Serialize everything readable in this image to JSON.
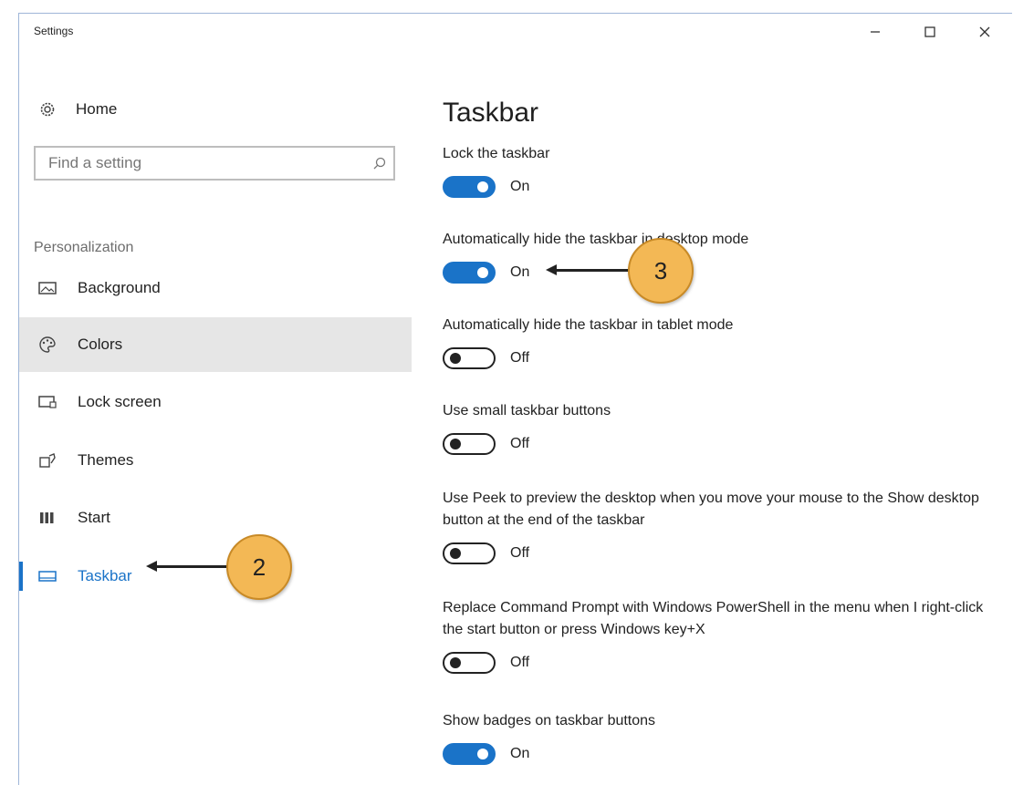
{
  "window": {
    "title": "Settings",
    "controls": {
      "minimize": "–",
      "maximize": "☐",
      "close": "✕"
    }
  },
  "sidebar": {
    "home_label": "Home",
    "search": {
      "placeholder": "Find a setting"
    },
    "section_label": "Personalization",
    "items": [
      {
        "label": "Background",
        "icon": "background-icon"
      },
      {
        "label": "Colors",
        "icon": "colors-icon"
      },
      {
        "label": "Lock screen",
        "icon": "lock-screen-icon"
      },
      {
        "label": "Themes",
        "icon": "themes-icon"
      },
      {
        "label": "Start",
        "icon": "start-icon"
      },
      {
        "label": "Taskbar",
        "icon": "taskbar-icon"
      }
    ],
    "hovered_item": "Colors",
    "selected_item": "Taskbar"
  },
  "main": {
    "title": "Taskbar",
    "settings": [
      {
        "label": "Lock the taskbar",
        "state": "On"
      },
      {
        "label": "Automatically hide the taskbar in desktop mode",
        "state": "On"
      },
      {
        "label": "Automatically hide the taskbar in tablet mode",
        "state": "Off"
      },
      {
        "label": "Use small taskbar buttons",
        "state": "Off"
      },
      {
        "label": "Use Peek to preview the desktop when you move your mouse to the Show desktop button at the end of the taskbar",
        "state": "Off"
      },
      {
        "label": "Replace Command Prompt with Windows PowerShell in the menu when I right-click the start button or press Windows key+X",
        "state": "Off"
      },
      {
        "label": "Show badges on taskbar buttons",
        "state": "On"
      }
    ]
  },
  "callouts": [
    {
      "number": "2",
      "target": "Taskbar"
    },
    {
      "number": "3",
      "target": "Automatically hide the taskbar in desktop mode"
    }
  ],
  "colors": {
    "accent": "#1a73c8",
    "callout_fill": "#f3b855",
    "hover_bg": "#e6e6e6"
  }
}
